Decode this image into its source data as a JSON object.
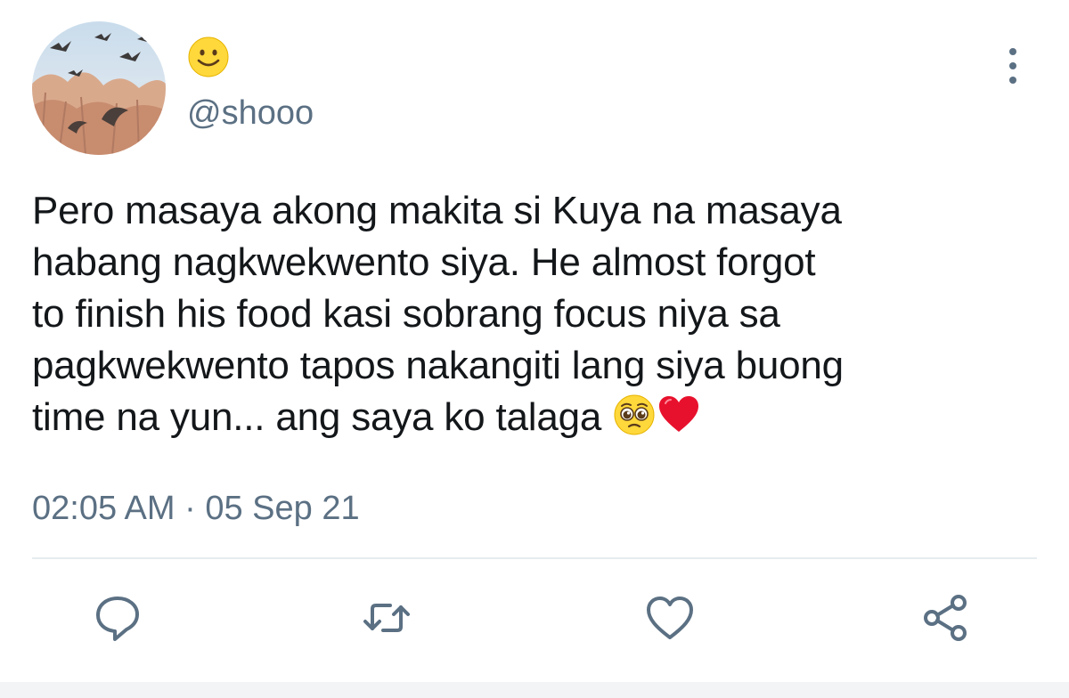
{
  "user": {
    "handle": "@shooo",
    "display_name_icon": "smiling-face-emoji",
    "avatar_icon": "birds-flying-avatar"
  },
  "tweet": {
    "lines": [
      "Pero masaya akong makita si Kuya na masaya",
      "habang nagkwekwento siya. He almost forgot",
      "to finish his food kasi sobrang focus niya sa",
      "pagkwekwento tapos nakangiti lang siya buong",
      "time na yun... ang saya ko talaga "
    ],
    "trailing_emoji": [
      "pleading-face-emoji",
      "red-heart-emoji"
    ]
  },
  "meta": {
    "timestamp": "02:05 AM · 05 Sep 21"
  },
  "actions": {
    "reply_icon": "reply-icon",
    "retweet_icon": "retweet-icon",
    "like_icon": "like-icon",
    "share_icon": "share-icon",
    "more_icon": "more-vertical-icon"
  },
  "colors": {
    "text": "#14171a",
    "secondary": "#5b7083",
    "divider": "#e6ecf0"
  }
}
